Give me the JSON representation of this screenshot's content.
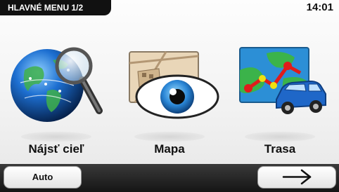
{
  "header": {
    "menu_title": "HLAVNÉ MENU 1/2",
    "time": "14:01"
  },
  "tiles": [
    {
      "label": "Nájsť cieľ",
      "icon": "globe-search-icon"
    },
    {
      "label": "Mapa",
      "icon": "map-eye-icon"
    },
    {
      "label": "Trasa",
      "icon": "route-car-icon"
    }
  ],
  "bottom_bar": {
    "left_button": "Auto",
    "right_button_icon": "arrow-right-icon"
  },
  "colors": {
    "bar": "#151515",
    "globe": "#1d6fd1",
    "route": "#e01b1b",
    "car": "#1f67c8"
  }
}
